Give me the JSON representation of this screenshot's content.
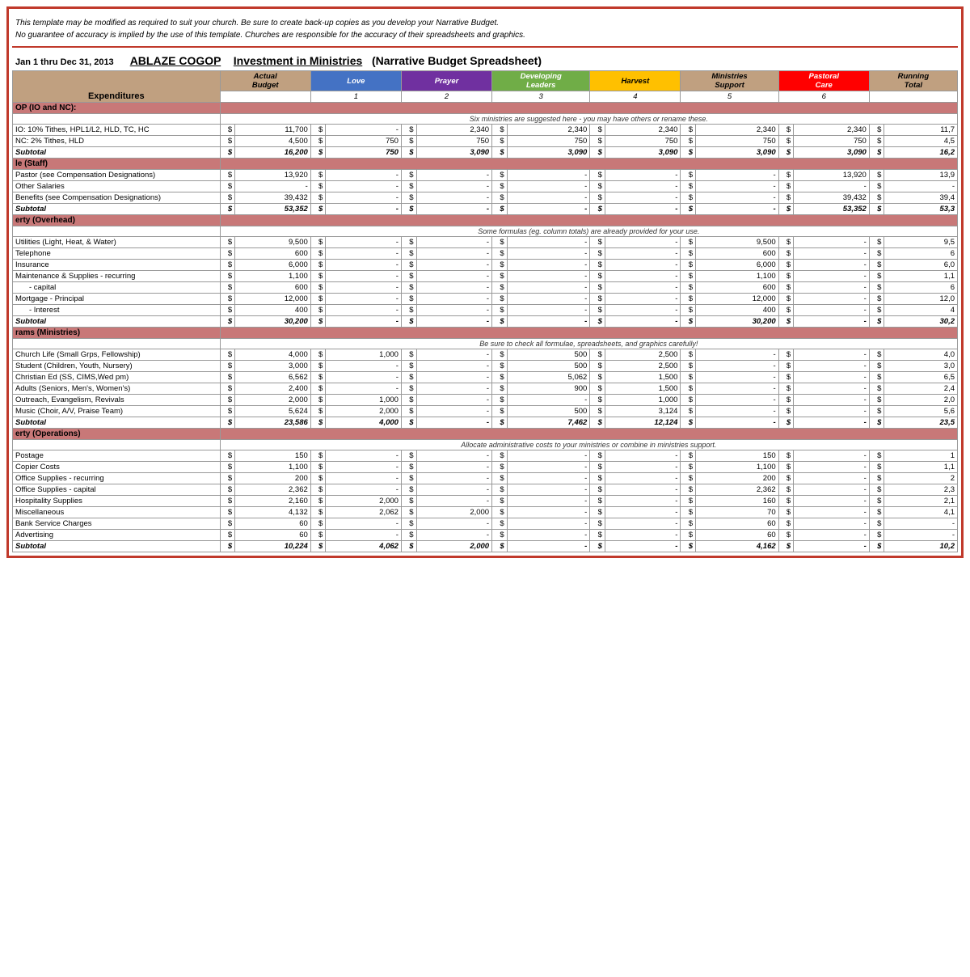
{
  "disclaimer": {
    "line1": "This template may be modified as required to suit your church.  Be sure to create back-up copies as you develop your Narrative Budget.",
    "line2": "No guarantee of accuracy is implied by the use of this template.  Churches are responsible for the accuracy of their spreadsheets and graphics."
  },
  "title": {
    "date_range": "Jan 1 thru Dec 31, 2013",
    "org": "ABLAZE COGOP",
    "subtitle": "Investment in Ministries",
    "type": "(Narrative Budget Spreadsheet)"
  },
  "headers": {
    "expenditures": "Expenditures",
    "actual_budget": "Actual\nBudget",
    "love": "Love",
    "love_num": "1",
    "prayer": "Prayer",
    "prayer_num": "2",
    "developing": "Developing\nLeaders",
    "developing_num": "3",
    "harvest": "Harvest",
    "harvest_num": "4",
    "ministries": "Ministries\nSupport",
    "ministries_num": "5",
    "pastoral": "Pastoral\nCare",
    "pastoral_num": "6",
    "running": "Running\nTotal"
  },
  "sections": [
    {
      "id": "op",
      "header": "OP (IO and NC):",
      "note": "Six ministries are suggested here - you may have others or rename these.",
      "rows": [
        {
          "label": "IO: 10% Tithes, HPL1/L2, HLD, TC, HC",
          "budget": "11,700",
          "love": "-",
          "prayer": "2,340",
          "developing": "2,340",
          "harvest": "2,340",
          "ministries": "2,340",
          "pastoral": "2,340",
          "running": "11,7"
        },
        {
          "label": "NC: 2% Tithes, HLD",
          "budget": "4,500",
          "love": "750",
          "prayer": "750",
          "developing": "750",
          "harvest": "750",
          "ministries": "750",
          "pastoral": "750",
          "running": "4,5"
        }
      ],
      "subtotal": {
        "label": "Subtotal",
        "budget": "16,200",
        "love": "750",
        "prayer": "3,090",
        "developing": "3,090",
        "harvest": "3,090",
        "ministries": "3,090",
        "pastoral": "3,090",
        "running": "16,2"
      }
    },
    {
      "id": "le",
      "header": "le (Staff)",
      "note": null,
      "rows": [
        {
          "label": "Pastor (see Compensation Designations)",
          "budget": "13,920",
          "love": "-",
          "prayer": "-",
          "developing": "-",
          "harvest": "-",
          "ministries": "-",
          "pastoral": "13,920",
          "running": "13,9"
        },
        {
          "label": "Other Salaries",
          "budget": "-",
          "love": "-",
          "prayer": "-",
          "developing": "-",
          "harvest": "-",
          "ministries": "-",
          "pastoral": "-",
          "running": "-"
        },
        {
          "label": "Benefits (see Compensation Designations)",
          "budget": "39,432",
          "love": "-",
          "prayer": "-",
          "developing": "-",
          "harvest": "-",
          "ministries": "-",
          "pastoral": "39,432",
          "running": "39,4"
        }
      ],
      "subtotal": {
        "label": "Subtotal",
        "budget": "53,352",
        "love": "-",
        "prayer": "-",
        "developing": "-",
        "harvest": "-",
        "ministries": "-",
        "pastoral": "53,352",
        "running": "53,3"
      }
    },
    {
      "id": "erty_overhead",
      "header": "erty (Overhead)",
      "note": "Some formulas (eg. column totals) are already provided for your use.",
      "rows": [
        {
          "label": "Utilities (Light, Heat, & Water)",
          "budget": "9,500",
          "love": "-",
          "prayer": "-",
          "developing": "-",
          "harvest": "-",
          "ministries": "9,500",
          "pastoral": "-",
          "running": "9,5"
        },
        {
          "label": "Telephone",
          "budget": "600",
          "love": "-",
          "prayer": "-",
          "developing": "-",
          "harvest": "-",
          "ministries": "600",
          "pastoral": "-",
          "running": "6"
        },
        {
          "label": "Insurance",
          "budget": "6,000",
          "love": "-",
          "prayer": "-",
          "developing": "-",
          "harvest": "-",
          "ministries": "6,000",
          "pastoral": "-",
          "running": "6,0"
        },
        {
          "label": "Maintenance & Supplies - recurring",
          "budget": "1,100",
          "love": "-",
          "prayer": "-",
          "developing": "-",
          "harvest": "-",
          "ministries": "1,100",
          "pastoral": "-",
          "running": "1,1"
        },
        {
          "label": "- capital",
          "budget": "600",
          "love": "-",
          "prayer": "-",
          "developing": "-",
          "harvest": "-",
          "ministries": "600",
          "pastoral": "-",
          "running": "6",
          "indent": true
        },
        {
          "label": "Mortgage  - Principal",
          "budget": "12,000",
          "love": "-",
          "prayer": "-",
          "developing": "-",
          "harvest": "-",
          "ministries": "12,000",
          "pastoral": "-",
          "running": "12,0"
        },
        {
          "label": "- Interest",
          "budget": "400",
          "love": "-",
          "prayer": "-",
          "developing": "-",
          "harvest": "-",
          "ministries": "400",
          "pastoral": "-",
          "running": "4",
          "indent": true
        }
      ],
      "subtotal": {
        "label": "Subtotal",
        "budget": "30,200",
        "love": "-",
        "prayer": "-",
        "developing": "-",
        "harvest": "-",
        "ministries": "30,200",
        "pastoral": "-",
        "running": "30,2"
      }
    },
    {
      "id": "rams_ministries",
      "header": "rams (Ministries)",
      "note": "Be sure to check all formulae, spreadsheets, and graphics carefully!",
      "rows": [
        {
          "label": "Church Life (Small Grps, Fellowship)",
          "budget": "4,000",
          "love": "1,000",
          "prayer": "-",
          "developing": "500",
          "harvest": "2,500",
          "ministries": "-",
          "pastoral": "-",
          "running": "4,0"
        },
        {
          "label": "Student (Children, Youth, Nursery)",
          "budget": "3,000",
          "love": "-",
          "prayer": "-",
          "developing": "500",
          "harvest": "2,500",
          "ministries": "-",
          "pastoral": "-",
          "running": "3,0"
        },
        {
          "label": "Christian Ed (SS, CIMS,Wed pm)",
          "budget": "6,562",
          "love": "-",
          "prayer": "-",
          "developing": "5,062",
          "harvest": "1,500",
          "ministries": "-",
          "pastoral": "-",
          "running": "6,5"
        },
        {
          "label": "Adults (Seniors, Men's, Women's)",
          "budget": "2,400",
          "love": "-",
          "prayer": "-",
          "developing": "900",
          "harvest": "1,500",
          "ministries": "-",
          "pastoral": "-",
          "running": "2,4"
        },
        {
          "label": "Outreach, Evangelism, Revivals",
          "budget": "2,000",
          "love": "1,000",
          "prayer": "-",
          "developing": "-",
          "harvest": "1,000",
          "ministries": "-",
          "pastoral": "-",
          "running": "2,0"
        },
        {
          "label": "Music (Choir, A/V, Praise Team)",
          "budget": "5,624",
          "love": "2,000",
          "prayer": "-",
          "developing": "500",
          "harvest": "3,124",
          "ministries": "-",
          "pastoral": "-",
          "running": "5,6"
        }
      ],
      "subtotal": {
        "label": "Subtotal",
        "budget": "23,586",
        "love": "4,000",
        "prayer": "-",
        "developing": "7,462",
        "harvest": "12,124",
        "ministries": "-",
        "pastoral": "-",
        "running": "23,5"
      }
    },
    {
      "id": "erty_operations",
      "header": "erty (Operations)",
      "note": "Allocate administrative costs to your ministries or combine in ministries support.",
      "rows": [
        {
          "label": "Postage",
          "budget": "150",
          "love": "-",
          "prayer": "-",
          "developing": "-",
          "harvest": "-",
          "ministries": "150",
          "pastoral": "-",
          "running": "1"
        },
        {
          "label": "Copier Costs",
          "budget": "1,100",
          "love": "-",
          "prayer": "-",
          "developing": "-",
          "harvest": "-",
          "ministries": "1,100",
          "pastoral": "-",
          "running": "1,1"
        },
        {
          "label": "Office Supplies - recurring",
          "budget": "200",
          "love": "-",
          "prayer": "-",
          "developing": "-",
          "harvest": "-",
          "ministries": "200",
          "pastoral": "-",
          "running": "2"
        },
        {
          "label": "Office Supplies - capital",
          "budget": "2,362",
          "love": "-",
          "prayer": "-",
          "developing": "-",
          "harvest": "-",
          "ministries": "2,362",
          "pastoral": "-",
          "running": "2,3"
        },
        {
          "label": "Hospitality Supplies",
          "budget": "2,160",
          "love": "2,000",
          "prayer": "-",
          "developing": "-",
          "harvest": "-",
          "ministries": "160",
          "pastoral": "-",
          "running": "2,1"
        },
        {
          "label": "Miscellaneous",
          "budget": "4,132",
          "love": "2,062",
          "prayer": "2,000",
          "developing": "-",
          "harvest": "-",
          "ministries": "70",
          "pastoral": "-",
          "running": "4,1"
        },
        {
          "label": "Bank Service Charges",
          "budget": "60",
          "love": "-",
          "prayer": "-",
          "developing": "-",
          "harvest": "-",
          "ministries": "60",
          "pastoral": "-",
          "running": "-"
        },
        {
          "label": "Advertising",
          "budget": "60",
          "love": "-",
          "prayer": "-",
          "developing": "-",
          "harvest": "-",
          "ministries": "60",
          "pastoral": "-",
          "running": "-"
        }
      ],
      "subtotal": {
        "label": "Subtotal",
        "budget": "10,224",
        "love": "4,062",
        "prayer": "2,000",
        "developing": "-",
        "harvest": "-",
        "ministries": "4,162",
        "pastoral": "-",
        "running": "10,2"
      }
    }
  ]
}
